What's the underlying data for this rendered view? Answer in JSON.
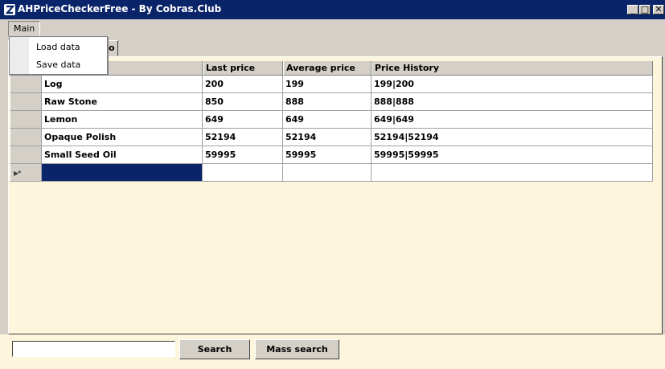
{
  "window": {
    "title": "AHPriceCheckerFree - By Cobras.Club",
    "minimize_glyph": "_",
    "maximize_glyph": "□",
    "close_glyph": "✕"
  },
  "menu": {
    "main_label": "Main",
    "items": [
      {
        "label": "Load data"
      },
      {
        "label": "Save data"
      }
    ]
  },
  "tab": {
    "visible_fragment": "o"
  },
  "grid": {
    "columns": [
      "",
      "Last price",
      "Average price",
      "Price History"
    ],
    "rows": [
      {
        "name": "Log",
        "last_price": "200",
        "average_price": "199",
        "price_history": "199|200"
      },
      {
        "name": "Raw Stone",
        "last_price": "850",
        "average_price": "888",
        "price_history": "888|888"
      },
      {
        "name": "Lemon",
        "last_price": "649",
        "average_price": "649",
        "price_history": "649|649"
      },
      {
        "name": "Opaque Polish",
        "last_price": "52194",
        "average_price": "52194",
        "price_history": "52194|52194"
      },
      {
        "name": "Small Seed Oil",
        "last_price": "59995",
        "average_price": "59995",
        "price_history": "59995|59995"
      }
    ],
    "new_row_glyph": "▶*"
  },
  "search": {
    "value": "",
    "search_label": "Search",
    "mass_search_label": "Mass search"
  },
  "colors": {
    "titlebar": "#0a246a",
    "panel": "#fdf5dc",
    "chrome": "#d4d0c8",
    "selection": "#0a246a"
  }
}
